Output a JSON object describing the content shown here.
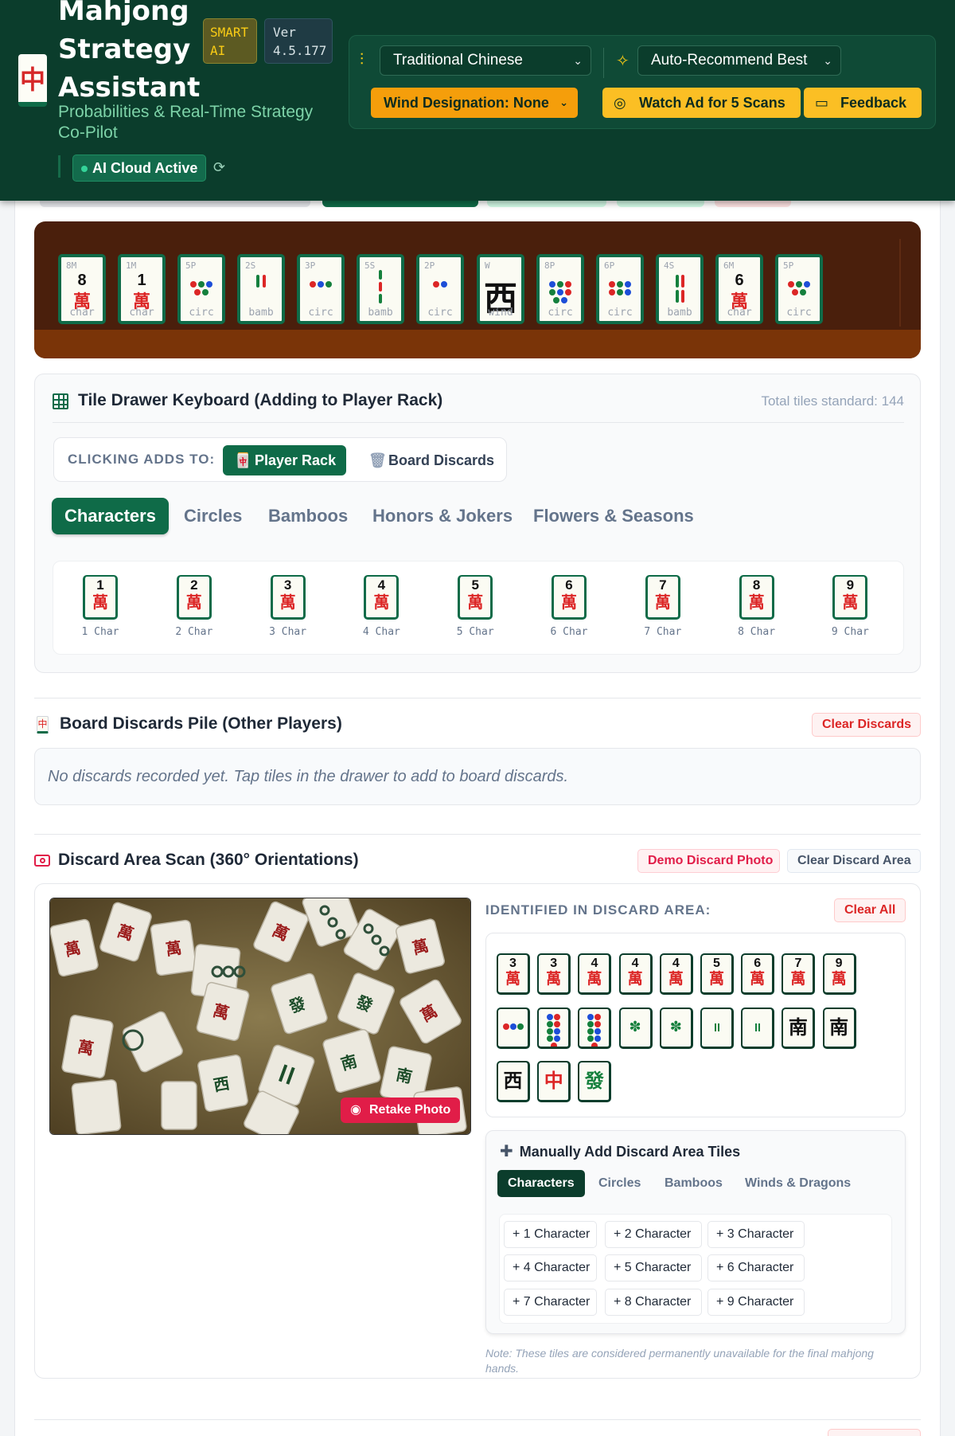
{
  "header": {
    "title": "Mahjong Strategy Assistant",
    "logo_glyph": "中",
    "badge_smart": "SMART AI",
    "badge_version": "Ver 4.5.177",
    "subtitle": "Probabilities & Real-Time Strategy Co-Pilot",
    "cloud_status": "AI Cloud Active",
    "ruleset_select": "Traditional Chinese",
    "mode_select": "Auto-Recommend Best",
    "wind_button": "Wind Designation: None",
    "watch_ad_button": "Watch Ad for 5 Scans",
    "feedback_button": "Feedback"
  },
  "rack": {
    "tiles": [
      {
        "code": "8M",
        "num": "8",
        "han": "萬",
        "suit": "char"
      },
      {
        "code": "1M",
        "num": "1",
        "han": "萬",
        "suit": "char"
      },
      {
        "code": "5P",
        "suit": "circ"
      },
      {
        "code": "2S",
        "suit": "bamb"
      },
      {
        "code": "3P",
        "suit": "circ"
      },
      {
        "code": "5S",
        "suit": "bamb"
      },
      {
        "code": "2P",
        "suit": "circ"
      },
      {
        "code": "W",
        "glyph": "西",
        "suit": "wind"
      },
      {
        "code": "8P",
        "suit": "circ"
      },
      {
        "code": "6P",
        "suit": "circ"
      },
      {
        "code": "4S",
        "suit": "bamb"
      },
      {
        "code": "6M",
        "num": "6",
        "han": "萬",
        "suit": "char"
      },
      {
        "code": "5P",
        "suit": "circ"
      }
    ]
  },
  "drawer": {
    "title": "Tile Drawer Keyboard (Adding to Player Rack)",
    "total_note": "Total tiles standard: 144",
    "clicking_adds_label": "CLICKING ADDS TO:",
    "target_player": "Player Rack",
    "target_discards": "Board Discards",
    "tabs": [
      "Characters",
      "Circles",
      "Bamboos",
      "Honors & Jokers",
      "Flowers & Seasons"
    ],
    "tiles": [
      {
        "n": "1",
        "h": "萬",
        "label": "1 Char"
      },
      {
        "n": "2",
        "h": "萬",
        "label": "2 Char"
      },
      {
        "n": "3",
        "h": "萬",
        "label": "3 Char"
      },
      {
        "n": "4",
        "h": "萬",
        "label": "4 Char"
      },
      {
        "n": "5",
        "h": "萬",
        "label": "5 Char"
      },
      {
        "n": "6",
        "h": "萬",
        "label": "6 Char"
      },
      {
        "n": "7",
        "h": "萬",
        "label": "7 Char"
      },
      {
        "n": "8",
        "h": "萬",
        "label": "8 Char"
      },
      {
        "n": "9",
        "h": "萬",
        "label": "9 Char"
      }
    ]
  },
  "discards": {
    "title": "Board Discards Pile (Other Players)",
    "clear_button": "Clear Discards",
    "empty_text": "No discards recorded yet. Tap tiles in the drawer to add to board discards."
  },
  "scan": {
    "title": "Discard Area Scan (360° Orientations)",
    "demo_button": "Demo Discard Photo",
    "clear_area_button": "Clear Discard Area",
    "retake_button": "Retake Photo",
    "identified_label": "IDENTIFIED IN DISCARD AREA:",
    "clear_all_button": "Clear All",
    "identified_tiles": [
      {
        "n": "3",
        "h": "萬"
      },
      {
        "n": "3",
        "h": "萬"
      },
      {
        "n": "4",
        "h": "萬"
      },
      {
        "n": "4",
        "h": "萬"
      },
      {
        "n": "4",
        "h": "萬"
      },
      {
        "n": "5",
        "h": "萬"
      },
      {
        "n": "6",
        "h": "萬"
      },
      {
        "n": "7",
        "h": "萬"
      },
      {
        "n": "9",
        "h": "萬"
      },
      {
        "g": "circ3"
      },
      {
        "g": "circ9"
      },
      {
        "g": "circ9"
      },
      {
        "g": "bird"
      },
      {
        "g": "bird"
      },
      {
        "g": "bamb2"
      },
      {
        "g": "bamb2"
      },
      {
        "g": "南"
      },
      {
        "g": "南"
      },
      {
        "g": "西"
      },
      {
        "g": "中",
        "color": "#dc2626"
      },
      {
        "g": "發",
        "color": "#15803d"
      }
    ],
    "manual_title": "Manually Add Discard Area Tiles",
    "manual_tabs": [
      "Characters",
      "Circles",
      "Bamboos",
      "Winds & Dragons"
    ],
    "add_buttons": [
      "+ 1 Character",
      "+ 2 Character",
      "+ 3 Character",
      "+ 4 Character",
      "+ 5 Character",
      "+ 6 Character",
      "+ 7 Character",
      "+ 8 Character",
      "+ 9 Character"
    ],
    "note": "Note: These tiles are considered permanently unavailable for the final mahjong hands."
  }
}
